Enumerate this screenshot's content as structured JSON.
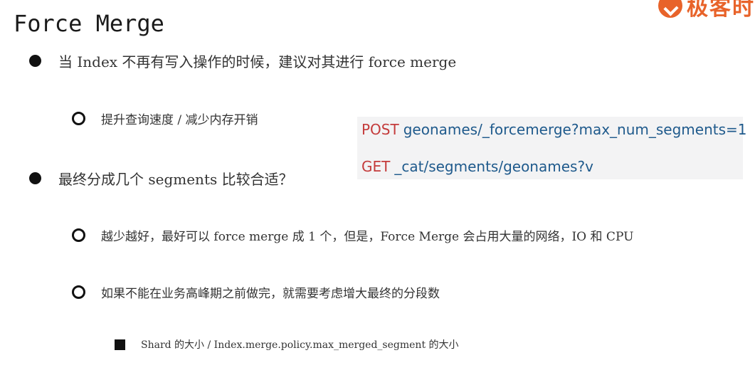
{
  "header": {
    "title": "Force Merge",
    "logo_text": "极客时"
  },
  "bullets": [
    {
      "text": "当 Index 不再有写入操作的时候，建议对其进行 force merge"
    },
    {
      "text": "最终分成几个 segments 比较合适？"
    }
  ],
  "sub_items": [
    {
      "text": "提升查询速度 / 减少内存开销"
    },
    {
      "text": "越少越好，最好可以 force merge 成 1 个，但是，Force Merge 会占用大量的网络，IO 和 CPU"
    },
    {
      "text": "如果不能在业务高峰期之前做完，就需要考虑增大最终的分段数"
    }
  ],
  "sub_sub_items": [
    {
      "text": "Shard 的大小 /  Index.merge.policy.max_merged_segment 的大小"
    }
  ],
  "code": [
    {
      "method": "POST",
      "path": "geonames/_forcemerge?max_num_segments=1"
    },
    {
      "method": "GET",
      "path": "_cat/segments/geonames?v"
    }
  ],
  "colors": {
    "logo": "#e8632a",
    "code_method": "#c43b3b",
    "code_path": "#1f5a8c",
    "code_background": "#f3f3f4"
  }
}
